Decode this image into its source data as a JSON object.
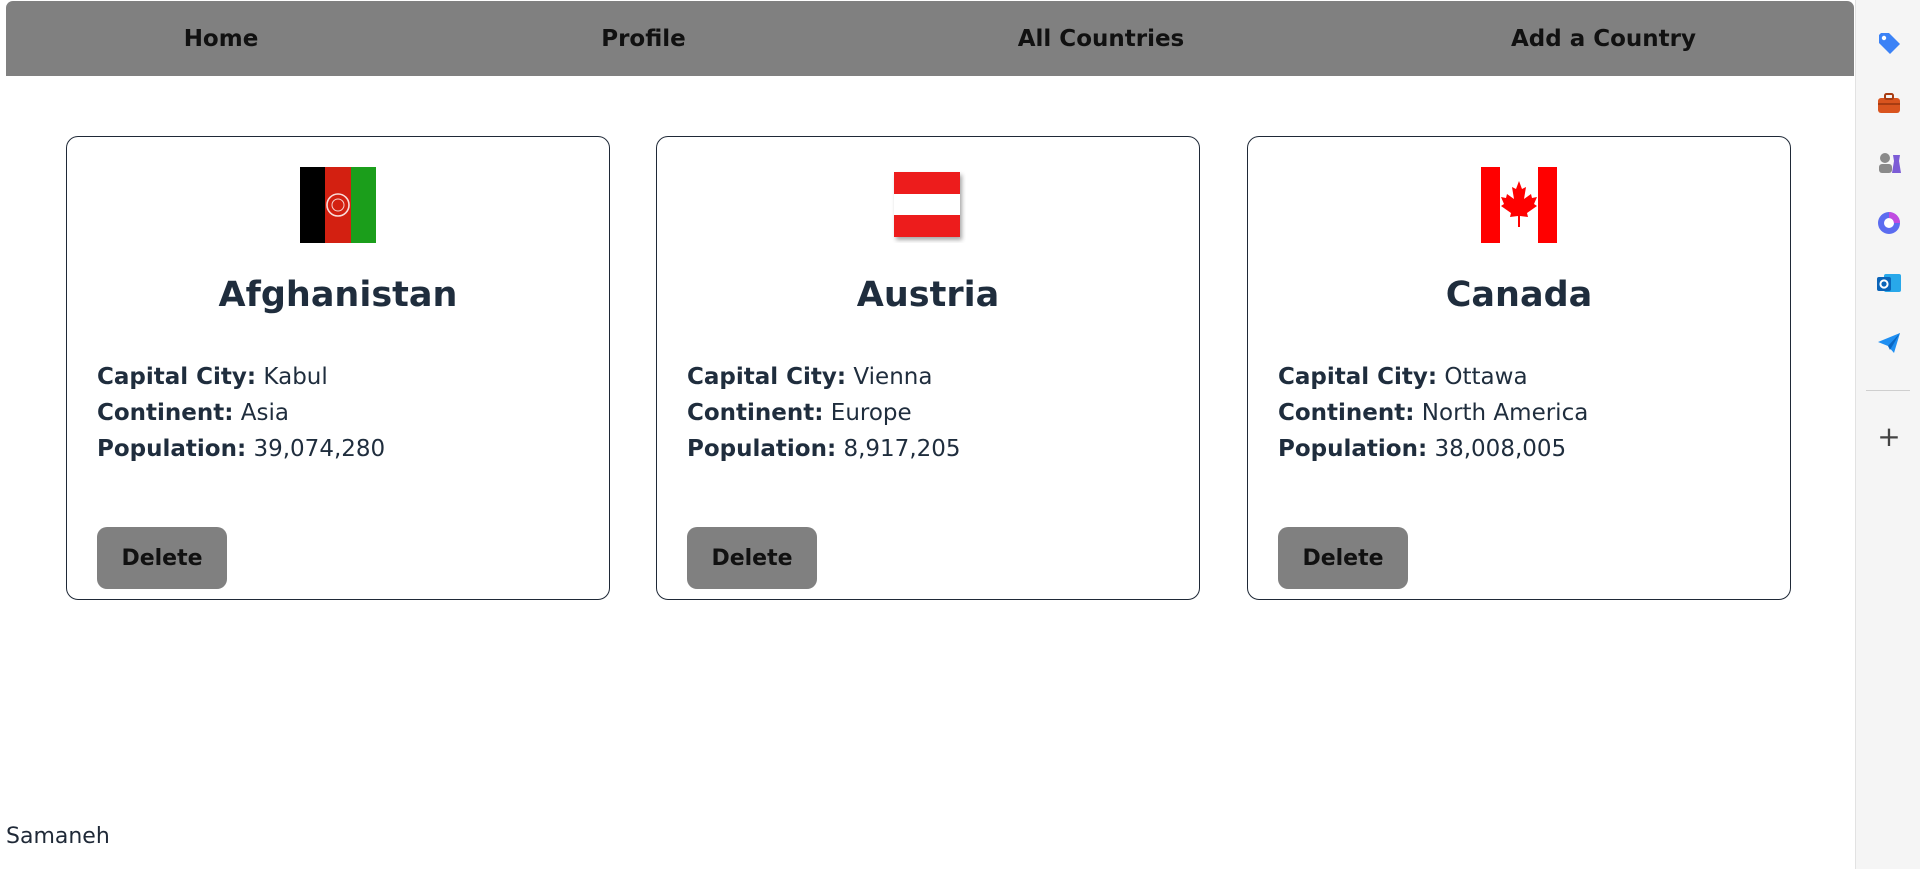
{
  "nav": {
    "home": "Home",
    "profile": "Profile",
    "all_countries": "All Countries",
    "add_country": "Add a Country"
  },
  "labels": {
    "capital": "Capital City:",
    "continent": "Continent:",
    "population": "Population:",
    "delete": "Delete"
  },
  "countries": [
    {
      "name": "Afghanistan",
      "capital": "Kabul",
      "continent": "Asia",
      "population": "39,074,280"
    },
    {
      "name": "Austria",
      "capital": "Vienna",
      "continent": "Europe",
      "population": "8,917,205"
    },
    {
      "name": "Canada",
      "capital": "Ottawa",
      "continent": "North America",
      "population": "38,008,005"
    }
  ],
  "footer": {
    "user": "Samaneh"
  },
  "sidebar": {
    "icons": [
      "tag-icon",
      "briefcase-icon",
      "games-icon",
      "copilot-icon",
      "outlook-icon",
      "send-icon"
    ],
    "add": "+"
  },
  "colors": {
    "navbar": "#808080",
    "button": "#808080",
    "text": "#1f2d3d"
  }
}
